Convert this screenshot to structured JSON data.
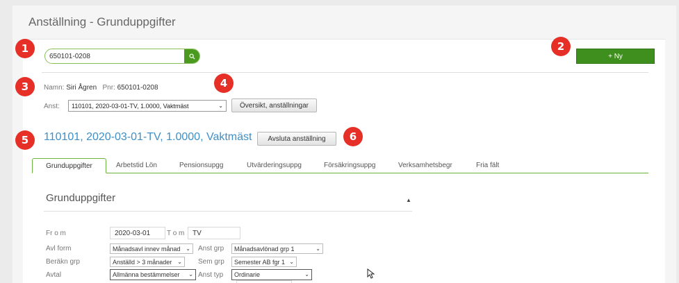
{
  "page": {
    "title": "Anställning - Grunduppgifter"
  },
  "markers": [
    "1",
    "2",
    "3",
    "4",
    "5",
    "6"
  ],
  "search": {
    "value": "650101-0208"
  },
  "new_button": {
    "label": "+ Ny"
  },
  "person": {
    "name_label": "Namn:",
    "name": "Siri Ågren",
    "pnr_label": "Pnr:",
    "pnr": "650101-0208"
  },
  "anst": {
    "label": "Anst:",
    "selected": "110101, 2020-03-01-TV, 1.0000, Vaktmäst",
    "overview_button": "Översikt, anställningar"
  },
  "employment": {
    "title": "110101, 2020-03-01-TV, 1.0000, Vaktmäst",
    "end_button": "Avsluta anställning"
  },
  "tabs": [
    "Grunduppgifter",
    "Arbetstid Lön",
    "Pensionsupgg",
    "Utvärderingsuppg",
    "Försäkringsuppg",
    "Verksamhetsbegr",
    "Fria fält"
  ],
  "section": {
    "title": "Grunduppgifter"
  },
  "form": {
    "from_label": "Fr o m",
    "from_value": "2020-03-01",
    "tom_label": "T o m",
    "tom_value": "TV",
    "avl_form_label": "Avl form",
    "avl_form_value": "Månadsavl innev månad",
    "anst_grp_label": "Anst grp",
    "anst_grp_value": "Månadsavlönad grp 1",
    "berakn_grp_label": "Beräkn grp",
    "berakn_grp_value": "Anställd > 3 månader",
    "sem_grp_label": "Sem grp",
    "sem_grp_value": "Semester AB fgr 1",
    "avtal_label": "Avtal",
    "avtal_value": "Allmänna bestämmelser",
    "anst_typ_label": "Anst typ",
    "anst_typ_value": "Ordinarie"
  }
}
